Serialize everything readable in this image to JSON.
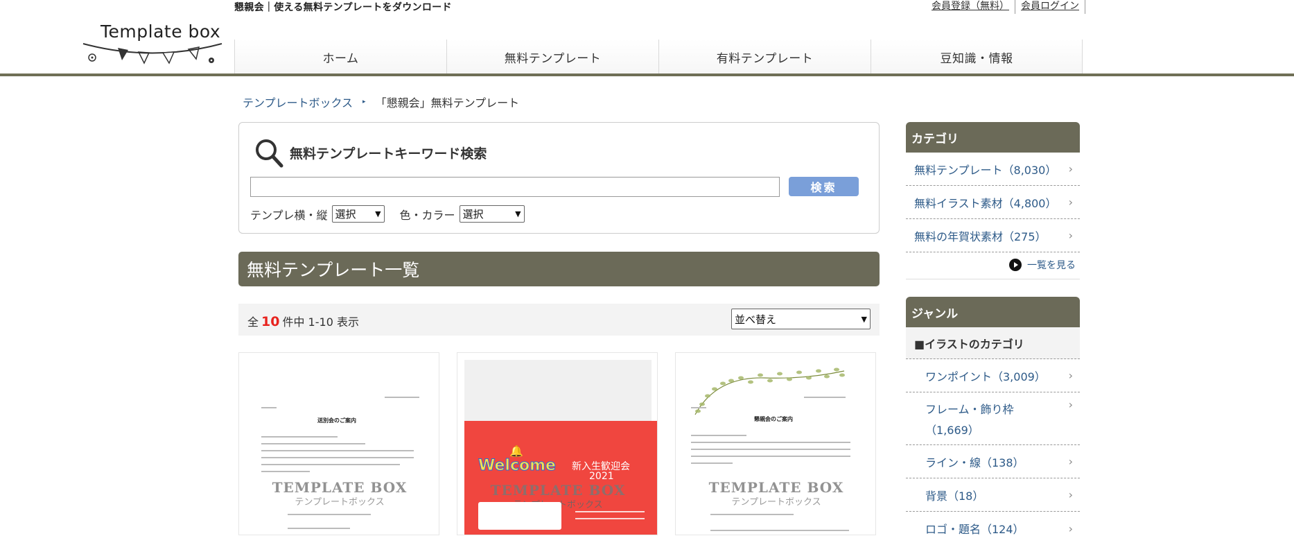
{
  "header": {
    "tagline": "懇親会｜使える無料テンプレートをダウンロード",
    "member_links": [
      "会員登録（無料）",
      "会員ログイン"
    ],
    "logo_text": "Template box",
    "nav": [
      "ホーム",
      "無料テンプレート",
      "有料テンプレート",
      "豆知識・情報"
    ]
  },
  "breadcrumb": {
    "home": "テンプレートボックス",
    "separator": "▸",
    "current": "「懇親会」無料テンプレート"
  },
  "search": {
    "title": "無料テンプレートキーワード検索",
    "input_value": "",
    "button": "検索",
    "filter1_label": "テンプレ横・縦",
    "filter1_value": "選択",
    "filter2_label": "色・カラー",
    "filter2_value": "選択"
  },
  "list": {
    "heading": "無料テンプレート一覧",
    "results_prefix": "全",
    "results_count": "10",
    "results_suffix": "件中 1-10 表示",
    "sort_value": "並べ替え"
  },
  "cards": [
    {
      "doc_title": "送別会のご案内",
      "watermark": "TEMPLATE BOX",
      "watermark_sub": "テンプレートボックス"
    },
    {
      "welcome": "Welcome",
      "event_title": "新入生歓迎会",
      "event_year": "2021",
      "watermark": "TEMPLATE BOX",
      "watermark_sub": "テンプレートボックス"
    },
    {
      "doc_title": "懇親会のご案内",
      "watermark": "TEMPLATE BOX",
      "watermark_sub": "テンプレートボックス"
    }
  ],
  "sidebar": {
    "category_title": "カテゴリ",
    "categories": [
      "無料テンプレート（8,030）",
      "無料イラスト素材（4,800）",
      "無料の年賀状素材（275）"
    ],
    "see_all": "一覧を見る",
    "genre_title": "ジャンル",
    "genre_sub": "■イラストのカテゴリ",
    "genres": [
      "ワンポイント（3,009）",
      "フレーム・飾り枠",
      "（1,669）",
      "ライン・線（138）",
      "背景（18）",
      "ロゴ・題名（124）"
    ]
  },
  "colors": {
    "brand": "#6b6a58",
    "link": "#2d5a88",
    "accent_count": "#e8231e",
    "search_button": "#7a9fd9",
    "card2_background": "#f0463f"
  }
}
